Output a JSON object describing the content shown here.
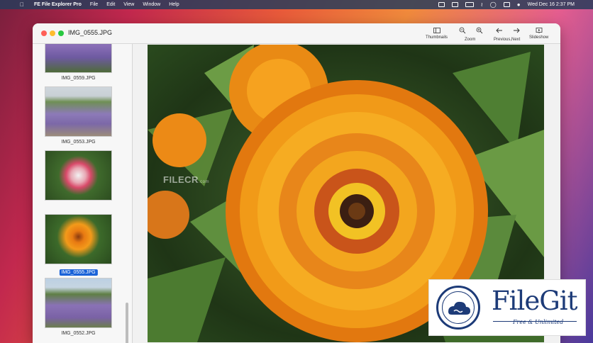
{
  "menubar": {
    "app_name": "FE File Explorer Pro",
    "menus": [
      "File",
      "Edit",
      "View",
      "Window",
      "Help"
    ],
    "clock": "Wed Dec 16  2:37 PM"
  },
  "window": {
    "title": "IMG_0555.JPG",
    "toolbar": {
      "thumbnails": "Thumbnails",
      "zoom": "Zoom",
      "previous_next": "Previous,Next",
      "slideshow": "Slideshow"
    }
  },
  "sidebar": {
    "items": [
      {
        "filename": "IMG_0559.JPG",
        "selected": false
      },
      {
        "filename": "IMG_0553.JPG",
        "selected": false
      },
      {
        "filename": "",
        "selected": false
      },
      {
        "filename": "IMG_0555.JPG",
        "selected": true
      },
      {
        "filename": "IMG_0552.JPG",
        "selected": false
      }
    ]
  },
  "watermark": {
    "filecr": "FILECR",
    "filecr_domain": ".com"
  },
  "badge": {
    "name": "FileGit",
    "tagline": "Free & Unlimited"
  },
  "colors": {
    "selection": "#1a63d8",
    "badge_text": "#1d3b78"
  }
}
